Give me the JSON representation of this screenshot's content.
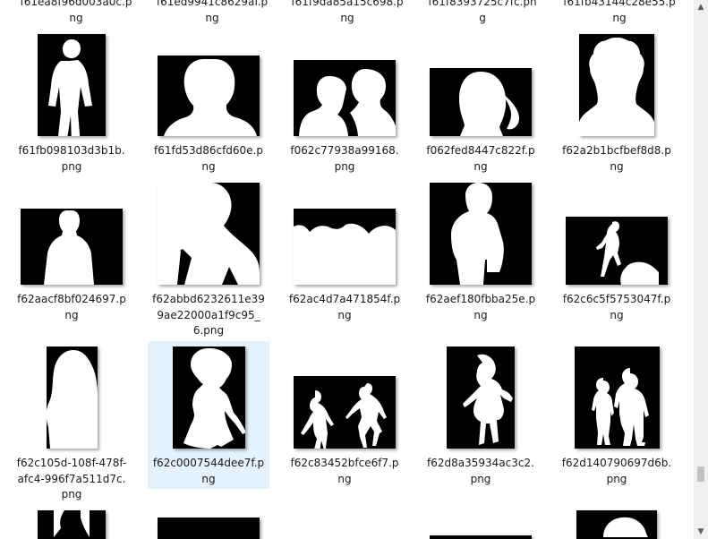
{
  "top_partial": [
    {
      "line1": "f61ea8f96d003a0c.p",
      "line2": "ng"
    },
    {
      "line1": "f61ed9941c8629af.p",
      "line2": "ng"
    },
    {
      "line1": "f61f9da85a15c698.p",
      "line2": "ng"
    },
    {
      "line1": "f61f8393725c7fc.pn",
      "line2": "g"
    },
    {
      "line1": "f61fb43144c28e55.p",
      "line2": "ng"
    }
  ],
  "files": [
    {
      "name": "f61fb098103d3b1b.png",
      "shape": "person-standing"
    },
    {
      "name": "f61fd53d86cfd60e.png",
      "shape": "head-shoulders"
    },
    {
      "name": "f062c77938a99168.png",
      "shape": "couple"
    },
    {
      "name": "f062fed8447c822f.png",
      "shape": "woman-long-hair"
    },
    {
      "name": "f62a2b1bcfbef8d8.png",
      "shape": "curly-hair-portrait"
    },
    {
      "name": "f62aacf8bf024697.png",
      "shape": "man-upper-body"
    },
    {
      "name": "f62abbd6232611e399ae22000a1f9c95_6.png",
      "shape": "dancer-closeup"
    },
    {
      "name": "f62ac4d7a471854f.png",
      "shape": "group-blob"
    },
    {
      "name": "f62aef180fbba25e.png",
      "shape": "person-upper-body"
    },
    {
      "name": "f62c6c5f5753047f.png",
      "shape": "running-and-crouch"
    },
    {
      "name": "f62c105d-108f-478f-afc4-996f7a511d7c.png",
      "shape": "woman-hair-side"
    },
    {
      "name": "f62c0007544dee7f.png",
      "shape": "girl-dress",
      "selected": true
    },
    {
      "name": "f62c83452bfce6f7.png",
      "shape": "two-dancers"
    },
    {
      "name": "f62d8a35934ac3c2.png",
      "shape": "child-dress"
    },
    {
      "name": "f62d140790697d6b.png",
      "shape": "two-people-walking"
    }
  ],
  "bottom_partial": [
    {
      "shape": "partial-person"
    },
    {
      "shape": "partial-dark"
    },
    {
      "shape": "partial-none"
    },
    {
      "shape": "partial-bar"
    },
    {
      "shape": "partial-head"
    }
  ],
  "scrollbar": {
    "up_arrow": "▲",
    "down_arrow": "▼"
  }
}
